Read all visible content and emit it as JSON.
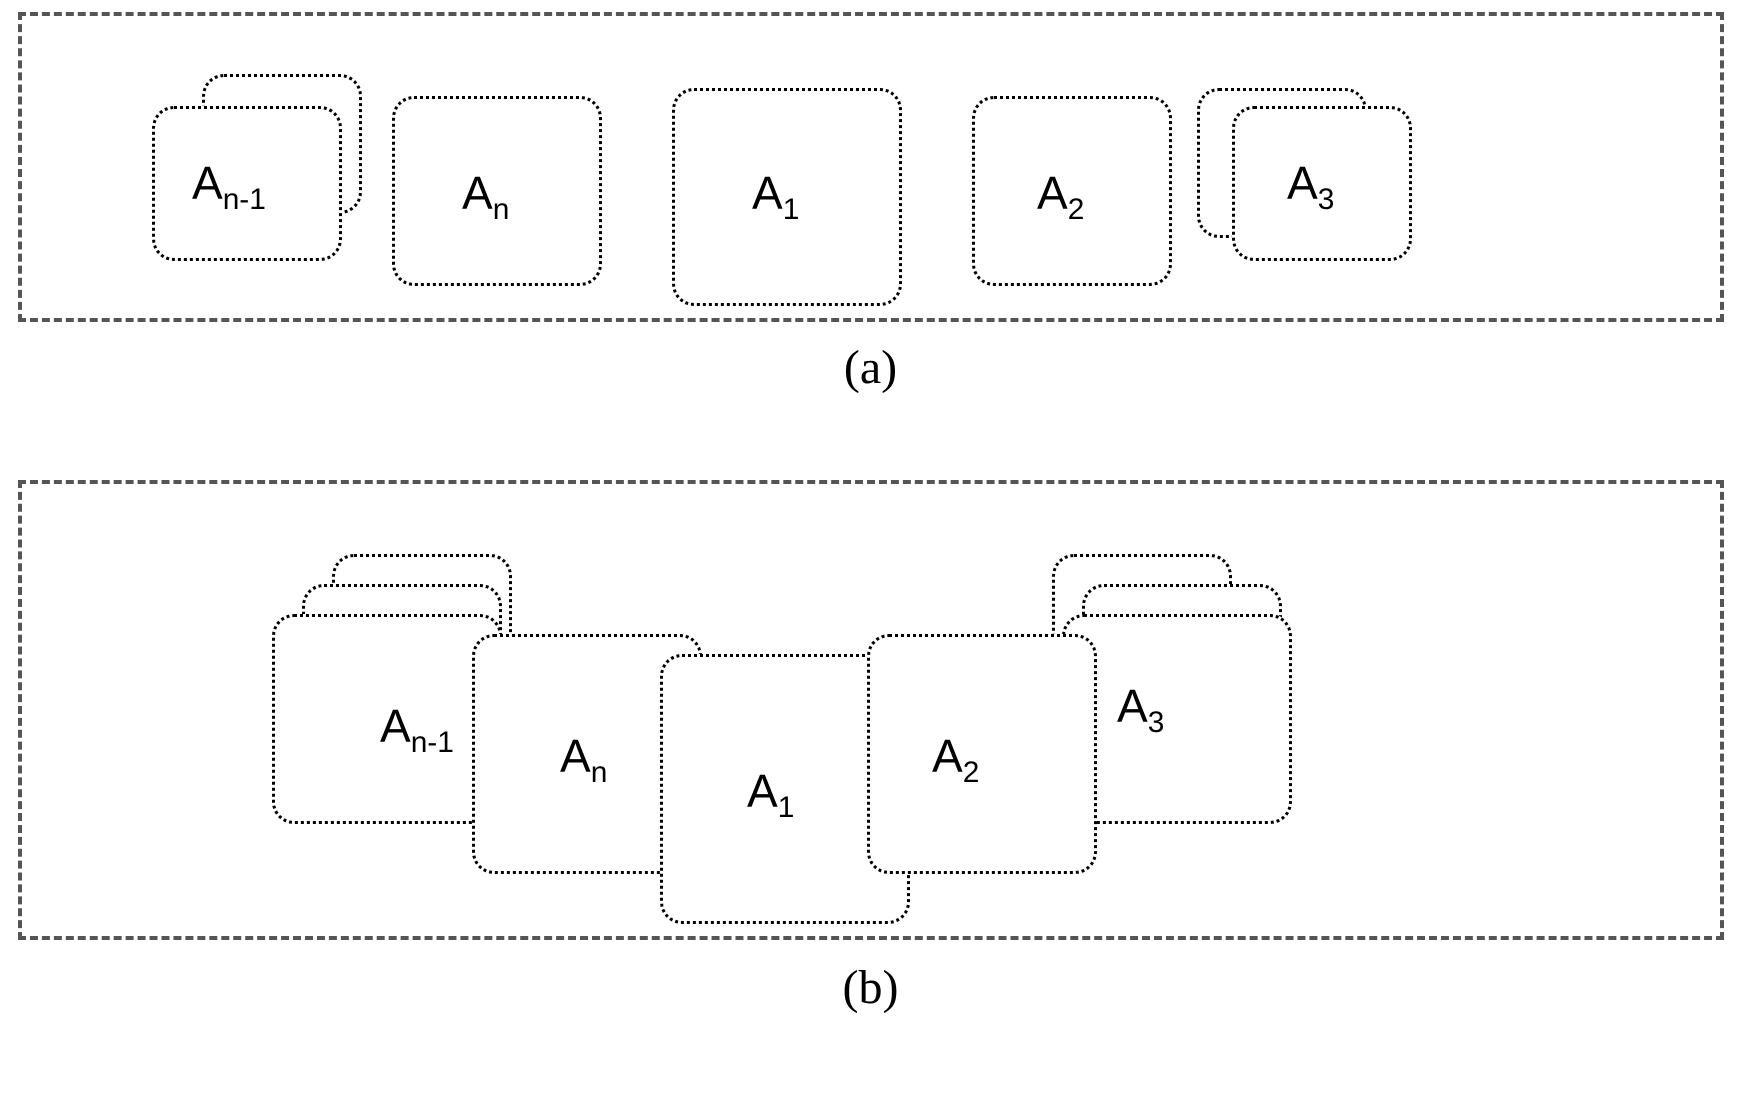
{
  "panel_a": {
    "caption": "(a)",
    "cards": {
      "n_minus_1": {
        "base": "A",
        "sub": "n-1"
      },
      "n": {
        "base": "A",
        "sub": "n"
      },
      "one": {
        "base": "A",
        "sub": "1"
      },
      "two": {
        "base": "A",
        "sub": "2"
      },
      "three": {
        "base": "A",
        "sub": "3"
      }
    }
  },
  "panel_b": {
    "caption": "(b)",
    "cards": {
      "n_minus_1": {
        "base": "A",
        "sub": "n-1"
      },
      "n": {
        "base": "A",
        "sub": "n"
      },
      "one": {
        "base": "A",
        "sub": "1"
      },
      "two": {
        "base": "A",
        "sub": "2"
      },
      "three": {
        "base": "A",
        "sub": "3"
      }
    }
  }
}
